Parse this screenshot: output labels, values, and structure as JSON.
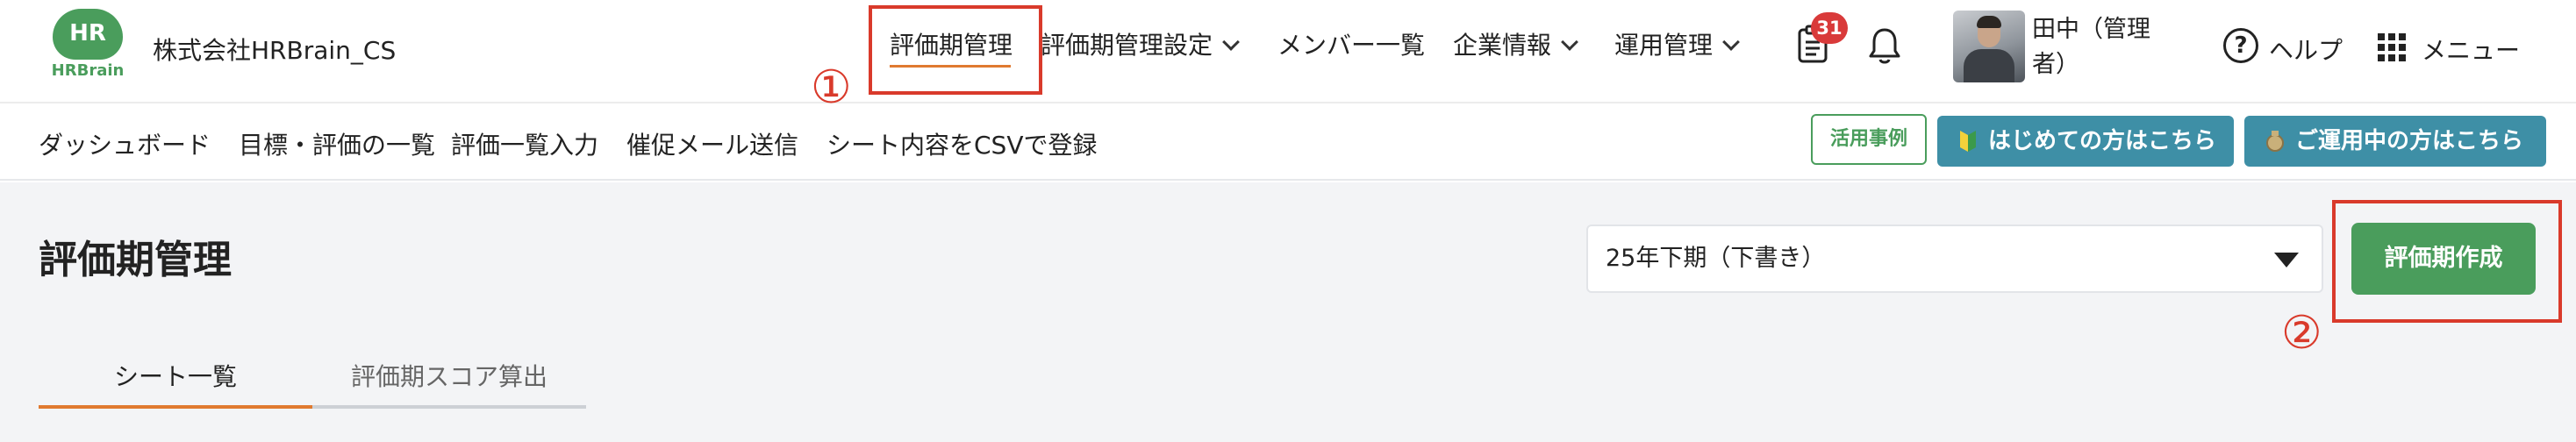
{
  "header": {
    "logo_badge": "HR",
    "logo_text": "HRBrain",
    "company_name": "株式会社HRBrain_CS",
    "nav": [
      {
        "label": "評価期管理",
        "active": true,
        "has_dropdown": false
      },
      {
        "label": "評価期管理設定",
        "active": false,
        "has_dropdown": true
      },
      {
        "label": "メンバー一覧",
        "active": false,
        "has_dropdown": false
      },
      {
        "label": "企業情報",
        "active": false,
        "has_dropdown": true
      },
      {
        "label": "運用管理",
        "active": false,
        "has_dropdown": true
      }
    ],
    "notification_count": "31",
    "user_name": "田中（管理者）",
    "help_label": "ヘルプ",
    "menu_label": "メニュー"
  },
  "annotations": {
    "marker_1": "①",
    "marker_2": "②",
    "color": "#d93a2b"
  },
  "subnav": {
    "items": [
      "ダッシュボード",
      "目標・評価の一覧",
      "評価一覧入力",
      "催促メール送信",
      "シート内容をCSVで登録"
    ],
    "case_button": "活用事例",
    "beginner_button": "はじめての方はこちら",
    "operating_button": "ご運用中の方はこちら"
  },
  "main": {
    "title": "評価期管理",
    "period_selected": "25年下期（下書き）",
    "create_button": "評価期作成",
    "tabs": [
      {
        "label": "シート一覧",
        "active": true
      },
      {
        "label": "評価期スコア算出",
        "active": false
      }
    ]
  },
  "colors": {
    "brand_green": "#4a9d5c",
    "accent_orange": "#e07a30",
    "teal": "#3e8fa6",
    "badge_red": "#d93a3a"
  }
}
